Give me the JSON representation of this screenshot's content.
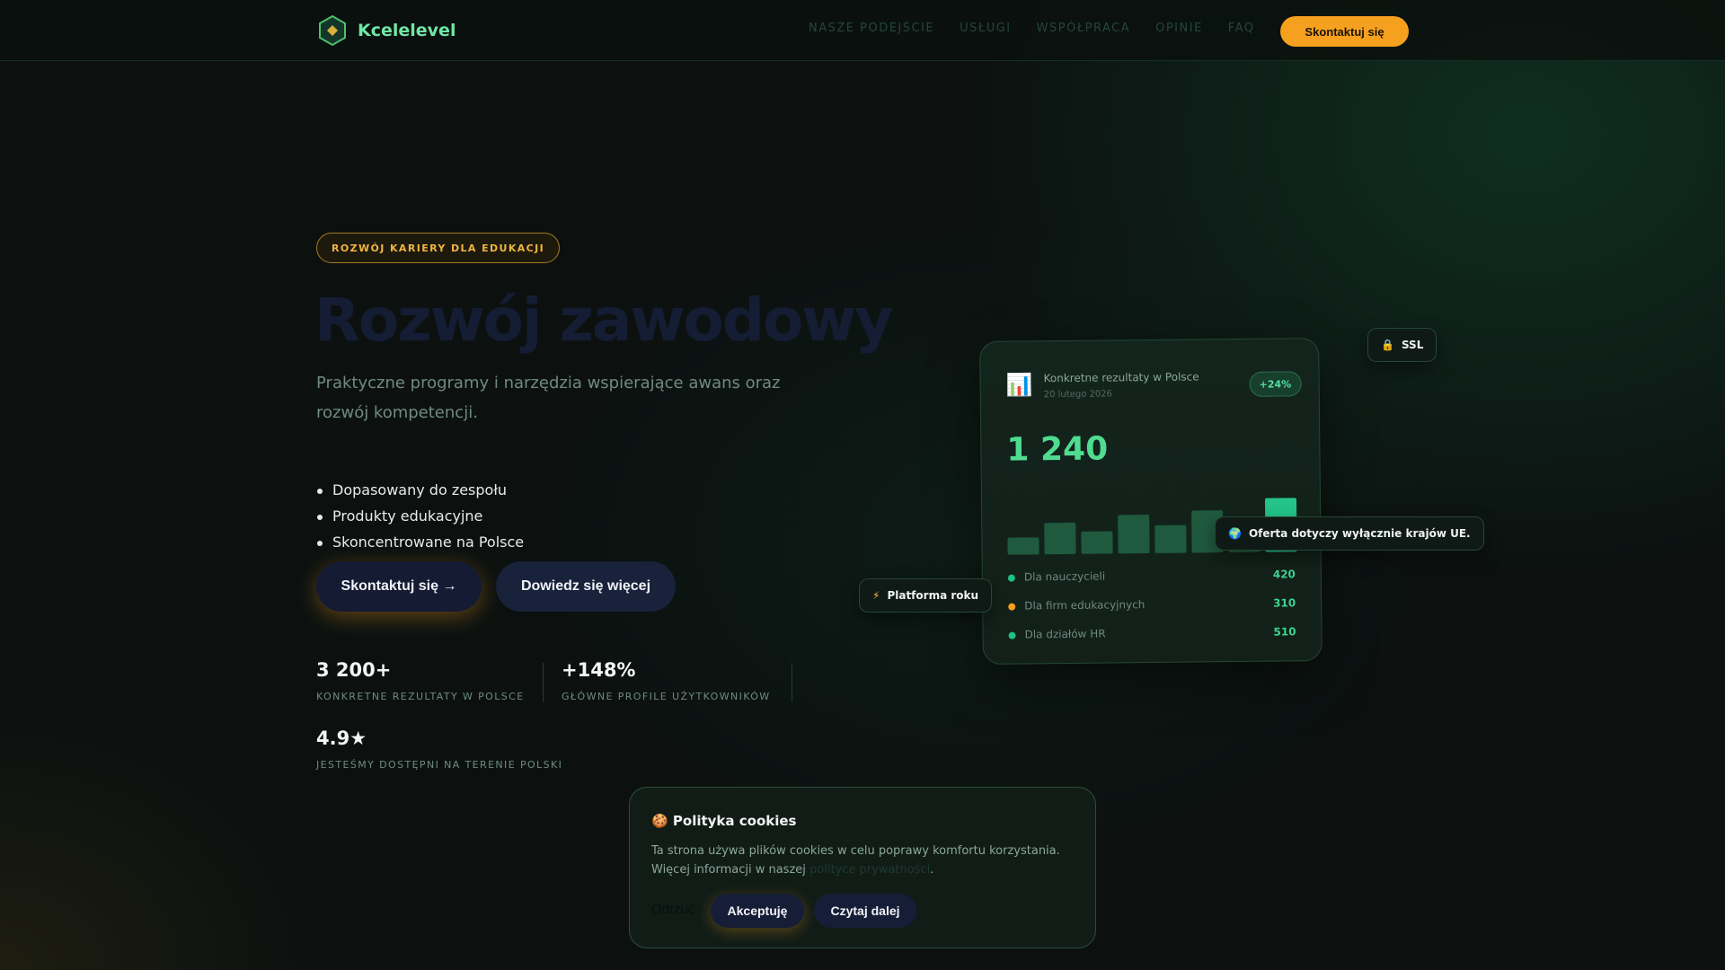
{
  "nav": {
    "brand": "Kcelelevel",
    "links": [
      "NASZE PODEJŚCIE",
      "USŁUGI",
      "WSPÓŁPRACA",
      "OPINIE",
      "FAQ"
    ],
    "cta": "Skontaktuj się"
  },
  "hero": {
    "badge": "ROZWÓJ KARIERY DLA EDUKACJI",
    "title": "Rozwój zawodowy",
    "subtitle": "Praktyczne programy i narzędzia wspierające awans oraz rozwój kompetencji.",
    "bullets": [
      "Dopasowany do zespołu",
      "Produkty edukacyjne",
      "Skoncentrowane na Polsce"
    ],
    "primary_button": "Skontaktuj się →",
    "secondary_button": "Dowiedz się więcej"
  },
  "stats": [
    {
      "value": "3 200+",
      "label": "KONKRETNE REZULTATY W POLSCE"
    },
    {
      "value": "+148%",
      "label": "GŁÓWNE PROFILE UŻYTKOWNIKÓW"
    },
    {
      "value": "4.9★",
      "label": "JESTEŚMY DOSTĘPNI NA TERENIE POLSKI"
    }
  ],
  "card": {
    "title": "Konkretne rezultaty w Polsce",
    "date": "20 lutego 2026",
    "change": "+24%",
    "value": "1 240",
    "bars": [
      0.32,
      0.58,
      0.42,
      0.72,
      0.52,
      0.78,
      0.4,
      1.0
    ],
    "legend": [
      {
        "label": "Dla nauczycieli",
        "value": "420",
        "color": "#1fbf86"
      },
      {
        "label": "Dla firm edukacyjnych",
        "value": "310",
        "color": "#f5a01e"
      },
      {
        "label": "Dla działów HR",
        "value": "510",
        "color": "#1fbf86"
      }
    ]
  },
  "chips": {
    "ssl": "SSL",
    "eu": "Oferta dotyczy wyłącznie krajów UE.",
    "platform": "Platforma roku"
  },
  "cookie": {
    "title": "🍪 Polityka cookies",
    "text_before": "Ta strona używa plików cookies w celu poprawy komfortu korzystania. Więcej informacji w naszej ",
    "link": "polityce prywatności",
    "text_after": ".",
    "reject": "Odrzuć",
    "accept": "Akceptuję",
    "more": "Czytaj dalej"
  },
  "colors": {
    "accent_orange": "#f5a01e",
    "accent_green": "#4fdc90",
    "background": "#0c1110"
  }
}
